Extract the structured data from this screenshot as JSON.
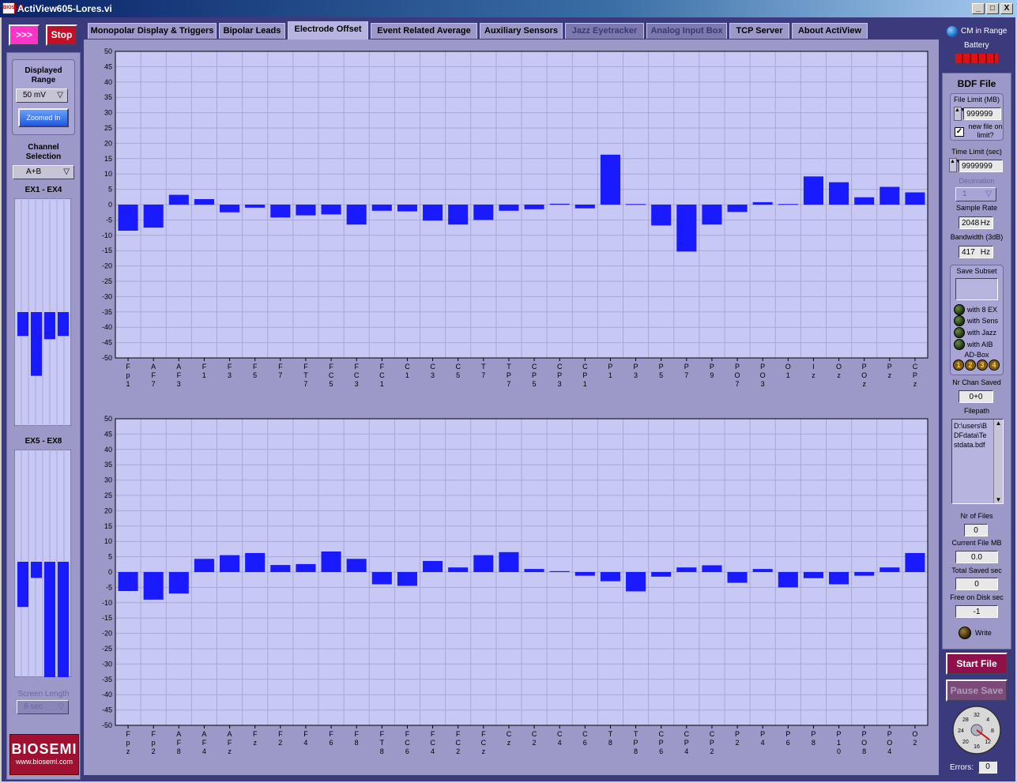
{
  "window": {
    "title": "ActiView605-Lores.vi",
    "icon_text": "BIOSEMI",
    "buttons": [
      "_",
      "□",
      "X"
    ]
  },
  "controls": {
    "run_label": ">>>",
    "stop_label": "Stop"
  },
  "tabs": [
    {
      "label": "Monopolar Display & Triggers",
      "state": "normal"
    },
    {
      "label": "Bipolar Leads",
      "state": "normal"
    },
    {
      "label": "Electrode Offset",
      "state": "active"
    },
    {
      "label": "Event Related Average",
      "state": "normal"
    },
    {
      "label": "Auxiliary Sensors",
      "state": "normal"
    },
    {
      "label": "Jazz Eyetracker",
      "state": "dim"
    },
    {
      "label": "Analog Input Box",
      "state": "dim"
    },
    {
      "label": "TCP Server",
      "state": "normal"
    },
    {
      "label": "About ActiView",
      "state": "normal"
    }
  ],
  "left": {
    "displayed_range_label": "Displayed Range",
    "displayed_range_value": "50 mV",
    "zoom_label": "Zoomed In",
    "channel_selection_label": "Channel Selection",
    "channel_selection_value": "A+B",
    "ex1_label": "EX1 - EX4",
    "ex5_label": "EX5 - EX8",
    "screen_length_label": "Screen Length",
    "screen_length_value": "8 sec",
    "ex1_values": [
      -15,
      -40,
      -17,
      -15
    ],
    "ex5_values": [
      -28,
      -10,
      -75,
      -75
    ],
    "logo_text": "BIOSEMI",
    "logo_url": "www.biosemi.com"
  },
  "chart_data": [
    {
      "type": "bar",
      "ylim": [
        -50,
        50
      ],
      "yticks": [
        50,
        45,
        40,
        35,
        30,
        25,
        20,
        15,
        10,
        5,
        0,
        -5,
        -10,
        -15,
        -20,
        -25,
        -30,
        -35,
        -40,
        -45,
        -50
      ],
      "categories": [
        "Fp1",
        "AF7",
        "AF3",
        "F1",
        "F3",
        "F5",
        "F7",
        "FT7",
        "FC5",
        "FC3",
        "FC1",
        "C1",
        "C3",
        "C5",
        "T7",
        "TP7",
        "CP5",
        "CP3",
        "CP1",
        "P1",
        "P3",
        "P5",
        "P7",
        "P9",
        "PO7",
        "PO3",
        "O1",
        "Iz",
        "Oz",
        "POz",
        "Pz",
        "CPz"
      ],
      "values": [
        -8.5,
        -7.5,
        3.2,
        1.8,
        -2.5,
        -1,
        -4.2,
        -3.5,
        -3.2,
        -6.5,
        -2,
        -2.2,
        -5.2,
        -6.5,
        -5,
        -2,
        -1.5,
        0.3,
        -1.2,
        16.3,
        0.2,
        -6.8,
        -15.3,
        -6.5,
        -2.4,
        0.8,
        0.2,
        9.2,
        7.3,
        2.4,
        5.8,
        4
      ],
      "grid": true
    },
    {
      "type": "bar",
      "ylim": [
        -50,
        50
      ],
      "yticks": [
        50,
        45,
        40,
        35,
        30,
        25,
        20,
        15,
        10,
        5,
        0,
        -5,
        -10,
        -15,
        -20,
        -25,
        -30,
        -35,
        -40,
        -45,
        -50
      ],
      "categories": [
        "Fpz",
        "Fp2",
        "AF8",
        "AF4",
        "AFz",
        "Fz",
        "F2",
        "F4",
        "F6",
        "F8",
        "FT8",
        "FC6",
        "FC4",
        "FC2",
        "FCz",
        "Cz",
        "C2",
        "C4",
        "C6",
        "T8",
        "TP8",
        "CP6",
        "CP4",
        "CP2",
        "P2",
        "P4",
        "P6",
        "P8",
        "P10",
        "PO8",
        "PO4",
        "O2"
      ],
      "values": [
        -6.2,
        -9,
        -7,
        4.3,
        5.5,
        6.2,
        2.3,
        2.6,
        6.7,
        4.3,
        -4,
        -4.5,
        3.6,
        1.5,
        5.5,
        6.5,
        1,
        0.3,
        -1.2,
        -3,
        -6.3,
        -1.5,
        1.5,
        2.2,
        -3.5,
        1,
        -5,
        -2,
        -4,
        -1.2,
        1.5,
        6.2
      ],
      "grid": true
    }
  ],
  "right": {
    "cm_label": "CM in Range",
    "battery_label": "Battery",
    "bdf_title": "BDF File",
    "file_limit_label": "File Limit (MB)",
    "file_limit_value": "999999",
    "new_file_label": "new file on limit?",
    "time_limit_label": "Time Limit (sec)",
    "time_limit_value": "9999999",
    "decimation_label": "Decimation",
    "decimation_value": "1",
    "sample_rate_label": "Sample Rate",
    "sample_rate_value": "2048",
    "sample_rate_unit": "Hz",
    "bandwidth_label": "Bandwidth (3dB)",
    "bandwidth_value": "417",
    "bandwidth_unit": "Hz",
    "save_subset_label": "Save Subset",
    "leds": [
      "with 8 EX",
      "with Sens",
      "with Jazz",
      "with AIB"
    ],
    "adbox_label": "AD-Box",
    "adbox_items": [
      "1",
      "2",
      "3",
      "4"
    ],
    "nr_chan_label": "Nr Chan Saved",
    "nr_chan_value": "0+0",
    "filepath_label": "Filepath",
    "filepath_value": "D:\\users\\BDFdata\\Testdata.bdf",
    "nr_files_label": "Nr of Files",
    "nr_files_value": "0",
    "current_file_label": "Current File MB",
    "current_file_value": "0.0",
    "total_saved_label": "Total Saved sec",
    "total_saved_value": "0",
    "free_disk_label": "Free on Disk sec",
    "free_disk_value": "-1",
    "write_label": "Write",
    "start_file_label": "Start File",
    "pause_save_label": "Pause Save",
    "dial_values": [
      "32",
      "4",
      "8",
      "12",
      "16",
      "20",
      "24",
      "28"
    ],
    "errors_label": "Errors:",
    "errors_value": "0"
  },
  "colors": {
    "bar": "#1a1aff",
    "plot_bg": "#c8c8f4",
    "frame": "#3a3a7c",
    "panel": "#9c98c8",
    "run": "#ff33cc",
    "stop": "#c0102a",
    "start_file": "#90104a"
  }
}
